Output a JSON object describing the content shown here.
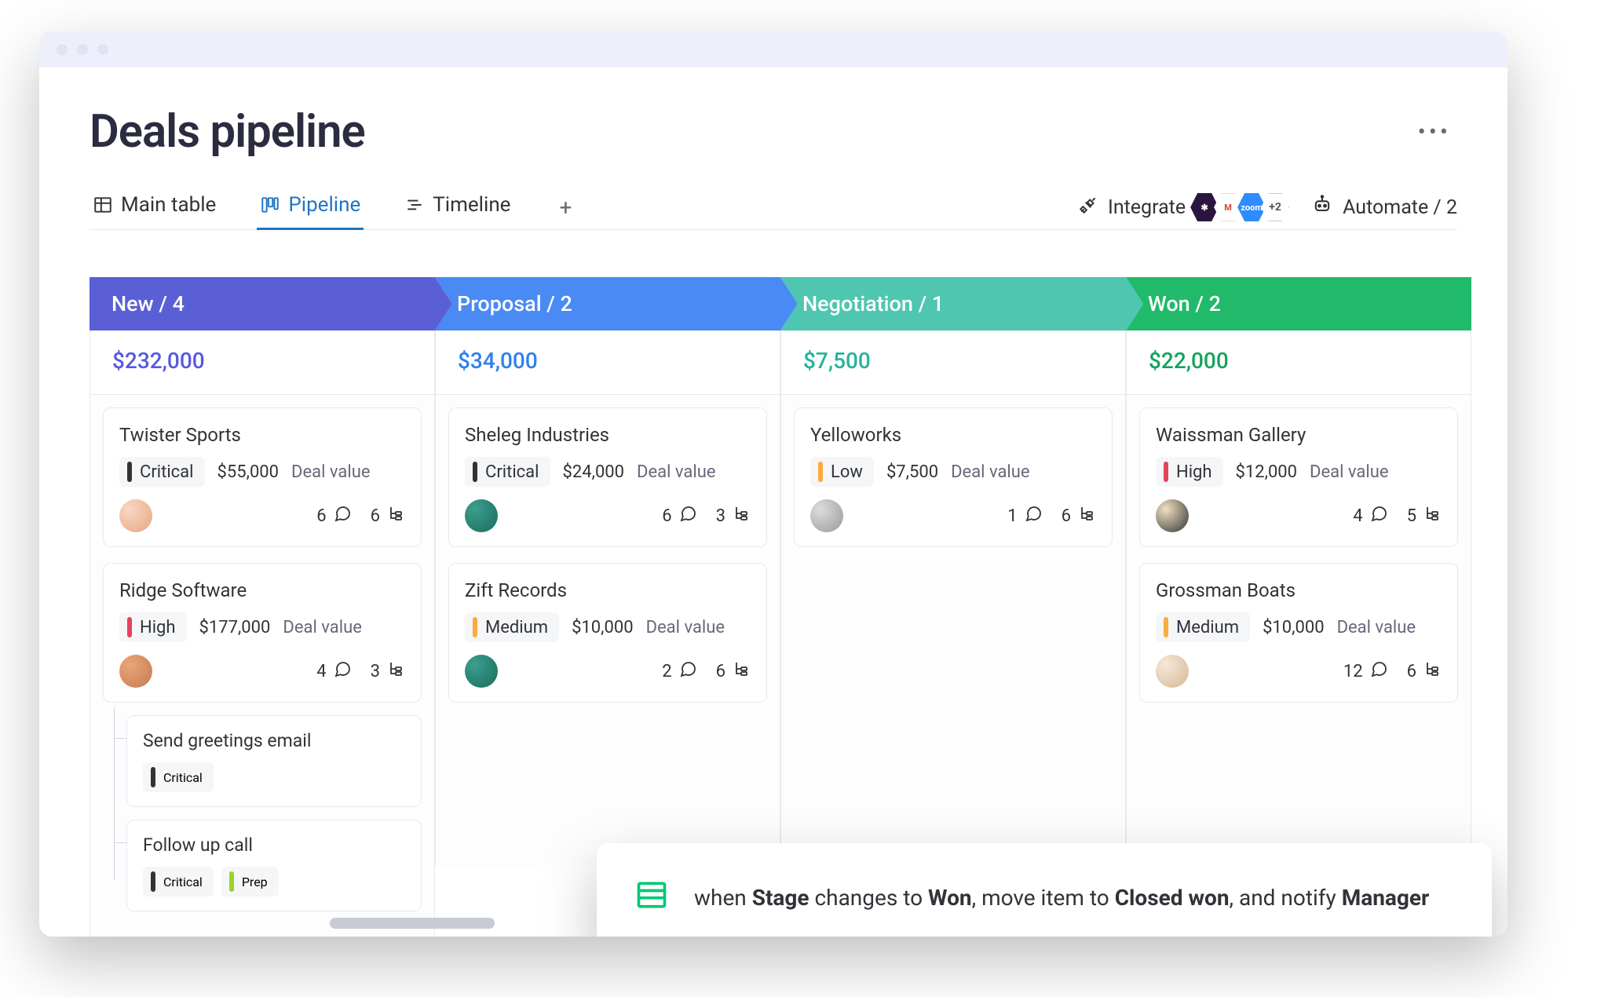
{
  "page": {
    "title": "Deals pipeline"
  },
  "tabs": {
    "main_table": "Main table",
    "pipeline": "Pipeline",
    "timeline": "Timeline"
  },
  "toolbar": {
    "integrate_label": "Integrate",
    "integrate_more": "+2",
    "automate_label": "Automate / 2"
  },
  "columns": [
    {
      "name": "New",
      "count": 4,
      "total": "$232,000",
      "header_color": "#5b5fd6",
      "total_color": "#5559df",
      "cards": [
        {
          "title": "Twister Sports",
          "priority": "Critical",
          "priority_class": "pri-critical",
          "value": "$55,000",
          "value_label": "Deal value",
          "avatar_class": "av-1",
          "comments": 6,
          "subitems": 6
        },
        {
          "title": "Ridge Software",
          "priority": "High",
          "priority_class": "pri-high",
          "value": "$177,000",
          "value_label": "Deal value",
          "avatar_class": "av-3",
          "comments": 4,
          "subitems": 3,
          "children": [
            {
              "title": "Send greetings email",
              "pills": [
                {
                  "label": "Critical",
                  "class": "pri-critical"
                }
              ]
            },
            {
              "title": "Follow up call",
              "pills": [
                {
                  "label": "Critical",
                  "class": "pri-critical"
                },
                {
                  "label": "Prep",
                  "class": "pri-prep"
                }
              ]
            }
          ]
        }
      ]
    },
    {
      "name": "Proposal",
      "count": 2,
      "total": "$34,000",
      "header_color": "#4a8af4",
      "total_color": "#2f80ed",
      "cards": [
        {
          "title": "Sheleg Industries",
          "priority": "Critical",
          "priority_class": "pri-critical",
          "value": "$24,000",
          "value_label": "Deal value",
          "avatar_class": "av-2",
          "comments": 6,
          "subitems": 3
        },
        {
          "title": "Zift Records",
          "priority": "Medium",
          "priority_class": "pri-medium",
          "value": "$10,000",
          "value_label": "Deal value",
          "avatar_class": "av-2",
          "comments": 2,
          "subitems": 6
        }
      ]
    },
    {
      "name": "Negotiation",
      "count": 1,
      "total": "$7,500",
      "header_color": "#4fc6b0",
      "total_color": "#26b29a",
      "cards": [
        {
          "title": "Yelloworks",
          "priority": "Low",
          "priority_class": "pri-low",
          "value": "$7,500",
          "value_label": "Deal value",
          "avatar_class": "av-4",
          "comments": 1,
          "subitems": 6
        }
      ]
    },
    {
      "name": "Won",
      "count": 2,
      "total": "$22,000",
      "header_color": "#20ba6a",
      "total_color": "#14a35d",
      "cards": [
        {
          "title": "Waissman Gallery",
          "priority": "High",
          "priority_class": "pri-high",
          "value": "$12,000",
          "value_label": "Deal value",
          "avatar_class": "av-5",
          "comments": 4,
          "subitems": 5
        },
        {
          "title": "Grossman Boats",
          "priority": "Medium",
          "priority_class": "pri-medium",
          "value": "$10,000",
          "value_label": "Deal value",
          "avatar_class": "av-6",
          "comments": 12,
          "subitems": 6
        }
      ]
    }
  ],
  "automation": {
    "prefix": "when ",
    "field1": "Stage",
    "mid1": " changes to ",
    "val1": "Won",
    "mid2": ", move item to ",
    "val2": "Closed won",
    "mid3": ", and notify ",
    "val3": "Manager"
  }
}
